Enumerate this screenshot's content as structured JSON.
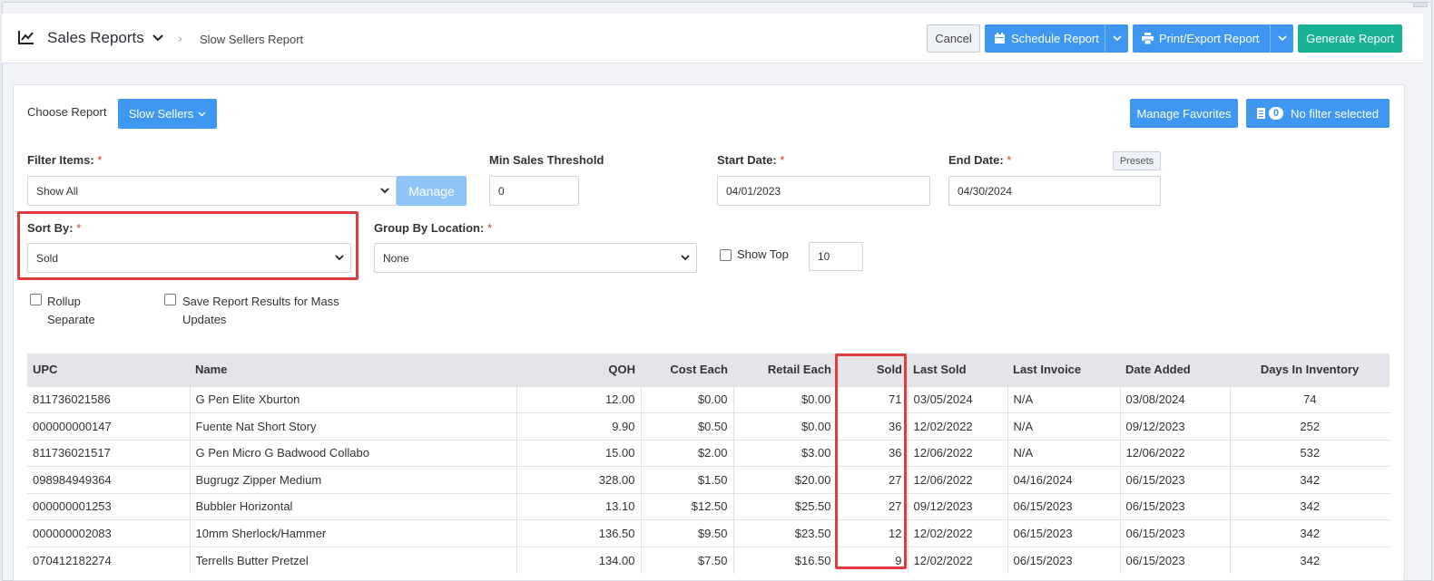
{
  "header": {
    "title": "Sales Reports",
    "breadcrumb": "Slow Sellers Report",
    "cancel_label": "Cancel",
    "schedule_label": "Schedule Report",
    "print_label": "Print/Export Report",
    "generate_label": "Generate Report"
  },
  "report": {
    "choose_label": "Choose Report",
    "selected": "Slow Sellers",
    "manage_favorites": "Manage Favorites",
    "filter_count": "0",
    "filter_text": "No filter selected"
  },
  "filters": {
    "filter_items_label": "Filter Items:",
    "filter_items_value": "Show All",
    "manage_label": "Manage",
    "min_sales_label": "Min Sales Threshold",
    "min_sales_value": "0",
    "start_date_label": "Start Date:",
    "start_date_value": "04/01/2023",
    "end_date_label": "End Date:",
    "end_date_value": "04/30/2024",
    "presets_label": "Presets",
    "sort_by_label": "Sort By:",
    "sort_by_value": "Sold",
    "group_by_label": "Group By Location:",
    "group_by_value": "None",
    "show_top_label": "Show Top",
    "show_top_value": "10",
    "rollup_label_1": "Rollup",
    "rollup_label_2": "Separate",
    "save_results_label_1": "Save Report Results for Mass",
    "save_results_label_2": "Updates",
    "required_mark": "*"
  },
  "table": {
    "columns": [
      "UPC",
      "Name",
      "QOH",
      "Cost Each",
      "Retail Each",
      "Sold",
      "Last Sold",
      "Last Invoice",
      "Date Added",
      "Days In Inventory"
    ],
    "rows": [
      [
        "811736021586",
        "G Pen Elite Xburton",
        "12.00",
        "$0.00",
        "$0.00",
        "71",
        "03/05/2024",
        "N/A",
        "03/08/2024",
        "74"
      ],
      [
        "000000000147",
        "Fuente Nat Short Story",
        "9.90",
        "$0.50",
        "$0.00",
        "36",
        "12/02/2022",
        "N/A",
        "09/12/2023",
        "252"
      ],
      [
        "811736021517",
        "G Pen Micro G Badwood Collabo",
        "15.00",
        "$2.00",
        "$3.00",
        "36",
        "12/06/2022",
        "N/A",
        "12/06/2022",
        "532"
      ],
      [
        "098984949364",
        "Bugrugz Zipper Medium",
        "328.00",
        "$1.50",
        "$20.00",
        "27",
        "12/06/2022",
        "04/16/2024",
        "06/15/2023",
        "342"
      ],
      [
        "000000001253",
        "Bubbler Horizontal",
        "13.10",
        "$12.50",
        "$25.50",
        "27",
        "09/12/2023",
        "06/15/2023",
        "06/15/2023",
        "342"
      ],
      [
        "000000002083",
        "10mm Sherlock/Hammer",
        "136.50",
        "$9.50",
        "$23.50",
        "12",
        "12/02/2022",
        "06/15/2023",
        "06/15/2023",
        "342"
      ],
      [
        "070412182274",
        "Terrells Butter Pretzel",
        "134.00",
        "$7.50",
        "$16.50",
        "9",
        "12/02/2022",
        "06/15/2023",
        "06/15/2023",
        "342"
      ]
    ]
  },
  "colors": {
    "primary": "#3e97f0",
    "generate": "#19b394",
    "highlight": "#e23b3b",
    "required": "#d83a3a"
  }
}
